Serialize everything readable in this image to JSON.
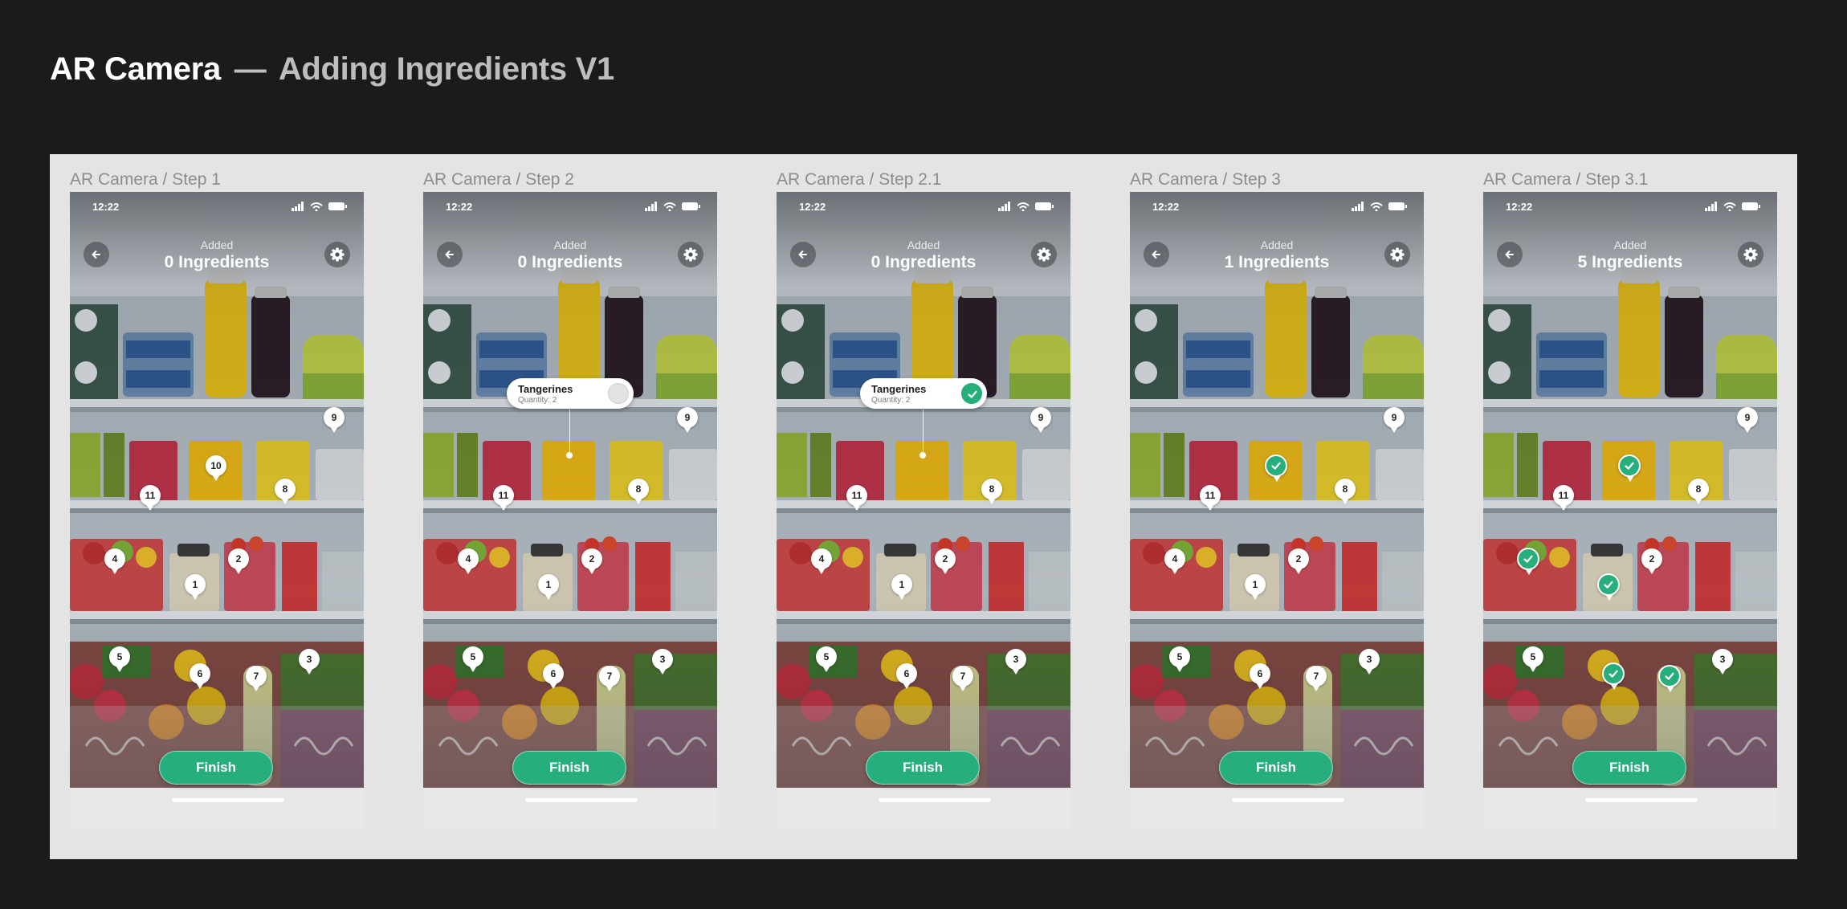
{
  "page": {
    "title_main": "AR Camera",
    "title_dash": "—",
    "title_sub": "Adding Ingredients V1"
  },
  "colors": {
    "accent": "#27ae7d",
    "background": "#1b1b1b",
    "board": "#e4e4e4"
  },
  "common": {
    "time": "12:22",
    "header_caption": "Added",
    "finish_label": "Finish",
    "back_icon": "arrow-left-icon",
    "settings_icon": "gear-icon"
  },
  "screens": [
    {
      "label": "AR Camera / Step 1",
      "count_label": "0 Ingredients",
      "pins": [
        {
          "id": "9",
          "checked": false
        },
        {
          "id": "10",
          "checked": false
        },
        {
          "id": "11",
          "checked": false
        },
        {
          "id": "8",
          "checked": false
        },
        {
          "id": "4",
          "checked": false
        },
        {
          "id": "1",
          "checked": false
        },
        {
          "id": "2",
          "checked": false
        },
        {
          "id": "5",
          "checked": false
        },
        {
          "id": "6",
          "checked": false
        },
        {
          "id": "7",
          "checked": false
        },
        {
          "id": "3",
          "checked": false
        }
      ],
      "popup": null
    },
    {
      "label": "AR Camera / Step 2",
      "count_label": "0 Ingredients",
      "pins": [
        {
          "id": "9",
          "checked": false
        },
        {
          "id": "11",
          "checked": false
        },
        {
          "id": "8",
          "checked": false
        },
        {
          "id": "4",
          "checked": false
        },
        {
          "id": "1",
          "checked": false
        },
        {
          "id": "2",
          "checked": false
        },
        {
          "id": "5",
          "checked": false
        },
        {
          "id": "6",
          "checked": false
        },
        {
          "id": "7",
          "checked": false
        },
        {
          "id": "3",
          "checked": false
        }
      ],
      "popup": {
        "name": "Tangerines",
        "quantity": "Quantity: 2",
        "checked": false
      }
    },
    {
      "label": "AR Camera / Step 2.1",
      "count_label": "0 Ingredients",
      "pins": [
        {
          "id": "9",
          "checked": false
        },
        {
          "id": "11",
          "checked": false
        },
        {
          "id": "8",
          "checked": false
        },
        {
          "id": "4",
          "checked": false
        },
        {
          "id": "1",
          "checked": false
        },
        {
          "id": "2",
          "checked": false
        },
        {
          "id": "5",
          "checked": false
        },
        {
          "id": "6",
          "checked": false
        },
        {
          "id": "7",
          "checked": false
        },
        {
          "id": "3",
          "checked": false
        }
      ],
      "popup": {
        "name": "Tangerines",
        "quantity": "Quantity: 2",
        "checked": true
      }
    },
    {
      "label": "AR Camera / Step 3",
      "count_label": "1 Ingredients",
      "pins": [
        {
          "id": "9",
          "checked": false
        },
        {
          "id": "10",
          "checked": true
        },
        {
          "id": "11",
          "checked": false
        },
        {
          "id": "8",
          "checked": false
        },
        {
          "id": "4",
          "checked": false
        },
        {
          "id": "1",
          "checked": false
        },
        {
          "id": "2",
          "checked": false
        },
        {
          "id": "5",
          "checked": false
        },
        {
          "id": "6",
          "checked": false
        },
        {
          "id": "7",
          "checked": false
        },
        {
          "id": "3",
          "checked": false
        }
      ],
      "popup": null
    },
    {
      "label": "AR Camera / Step 3.1",
      "count_label": "5 Ingredients",
      "pins": [
        {
          "id": "9",
          "checked": false
        },
        {
          "id": "10",
          "checked": true
        },
        {
          "id": "11",
          "checked": false
        },
        {
          "id": "8",
          "checked": false
        },
        {
          "id": "4",
          "checked": true
        },
        {
          "id": "1",
          "checked": true
        },
        {
          "id": "2",
          "checked": false
        },
        {
          "id": "5",
          "checked": false
        },
        {
          "id": "6",
          "checked": true
        },
        {
          "id": "7",
          "checked": true
        },
        {
          "id": "3",
          "checked": false
        }
      ],
      "popup": null
    }
  ]
}
